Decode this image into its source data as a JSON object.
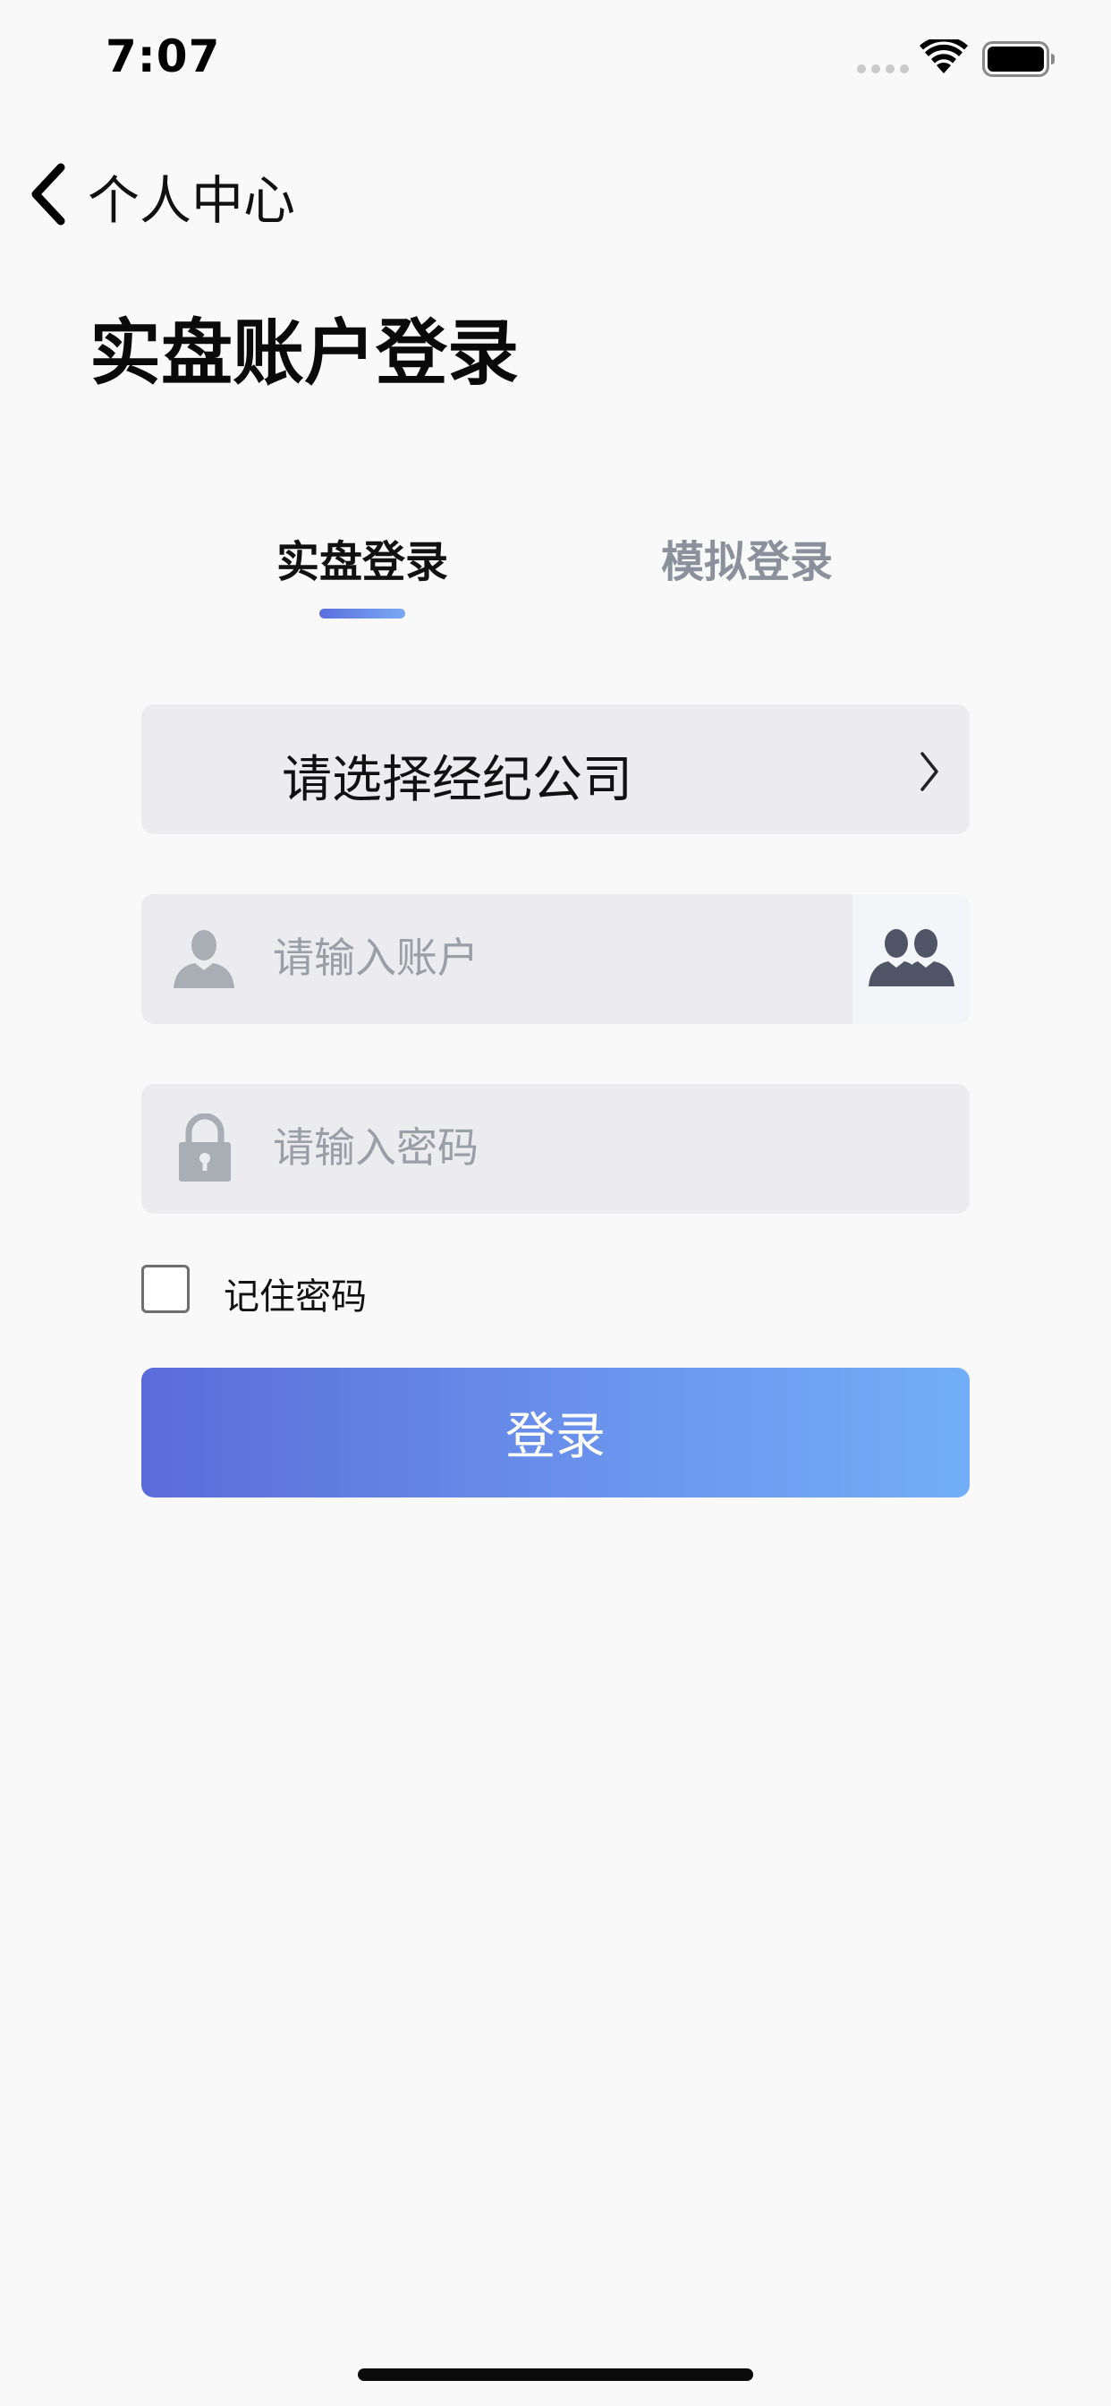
{
  "status_bar": {
    "time": "7:07"
  },
  "nav": {
    "back_label": "个人中心"
  },
  "page": {
    "title": "实盘账户登录"
  },
  "tabs": [
    {
      "label": "实盘登录",
      "active": true
    },
    {
      "label": "模拟登录",
      "active": false
    }
  ],
  "form": {
    "broker_placeholder": "请选择经纪公司",
    "account_placeholder": "请输入账户",
    "account_value": "",
    "password_placeholder": "请输入密码",
    "password_value": "",
    "remember_label": "记住密码",
    "remember_checked": false,
    "login_label": "登录"
  },
  "colors": {
    "background": "#f9f9f9",
    "field_background": "#ececee",
    "button_gradient_start": "#5b6cd9",
    "button_gradient_end": "#72aef8",
    "inactive_tab": "#8a919c"
  }
}
